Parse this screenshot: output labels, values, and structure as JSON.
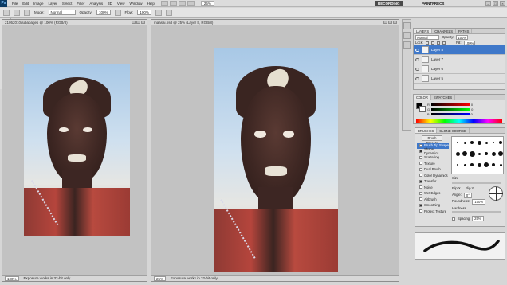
{
  "app": {
    "logo": "Ps",
    "menu": [
      "File",
      "Edit",
      "Image",
      "Layer",
      "Select",
      "Filter",
      "Analysis",
      "3D",
      "View",
      "Window",
      "Help"
    ],
    "zoom": "25%",
    "workspaces": {
      "recording": "RECORDING",
      "painting": "PAINTFRECS"
    }
  },
  "options": {
    "mode_label": "Mode:",
    "mode_value": "Normal",
    "opacity_label": "Opacity:",
    "opacity_value": "100%",
    "flow_label": "Flow:",
    "flow_value": "100%"
  },
  "doc_left": {
    "title": "21052010dubapages @ 100% (RGB/8)",
    "status_zoom": "100%",
    "status_text": "Exposure works in 32-bit only"
  },
  "doc_main": {
    "title": "maasai.psd @ 25% (Layer 8, RGB/8)",
    "status_zoom": "25%",
    "status_text": "Exposure works in 32-bit only"
  },
  "layers_panel": {
    "tabs": [
      "LAYERS",
      "CHANNELS",
      "PATHS"
    ],
    "blend_mode": "Normal",
    "opacity_label": "Opacity:",
    "opacity_value": "100%",
    "lock_label": "Lock:",
    "fill_label": "Fill:",
    "fill_value": "100%",
    "layers": [
      {
        "name": "Layer 8",
        "selected": true
      },
      {
        "name": "Layer 7",
        "selected": false
      },
      {
        "name": "Layer 6",
        "selected": false
      },
      {
        "name": "Layer 5",
        "selected": false
      }
    ]
  },
  "color_panel": {
    "tabs": [
      "COLOR",
      "SWATCHES"
    ],
    "channels": [
      "R",
      "G",
      "B"
    ],
    "values": [
      "0",
      "0",
      "0"
    ]
  },
  "brushes_panel": {
    "tabs": [
      "BRUSHES",
      "CLONE SOURCE"
    ],
    "presets_button": "Brush Presets",
    "options": [
      {
        "label": "Brush Tip Shape",
        "checked": false,
        "highlight": true
      },
      {
        "label": "Shape Dynamics",
        "checked": true,
        "highlight": false
      },
      {
        "label": "Scattering",
        "checked": false,
        "highlight": false
      },
      {
        "label": "Texture",
        "checked": false,
        "highlight": false
      },
      {
        "label": "Dual Brush",
        "checked": false,
        "highlight": false
      },
      {
        "label": "Color Dynamics",
        "checked": false,
        "highlight": false
      },
      {
        "label": "Transfer",
        "checked": true,
        "highlight": false
      },
      {
        "label": "Noise",
        "checked": false,
        "highlight": false
      },
      {
        "label": "Wet Edges",
        "checked": false,
        "highlight": false
      },
      {
        "label": "Airbrush",
        "checked": false,
        "highlight": false
      },
      {
        "label": "Smoothing",
        "checked": true,
        "highlight": false
      },
      {
        "label": "Protect Texture",
        "checked": false,
        "highlight": false
      }
    ],
    "size_label": "Size",
    "flip_x": "Flip X",
    "flip_y": "Flip Y",
    "angle_label": "Angle:",
    "angle_value": "0°",
    "roundness_label": "Roundness:",
    "roundness_value": "100%",
    "hardness_label": "Hardness",
    "spacing_label": "Spacing",
    "spacing_value": "25%"
  },
  "colors": {
    "selection": "#3f78c9",
    "foreground": "#000000",
    "background": "#ffffff"
  }
}
